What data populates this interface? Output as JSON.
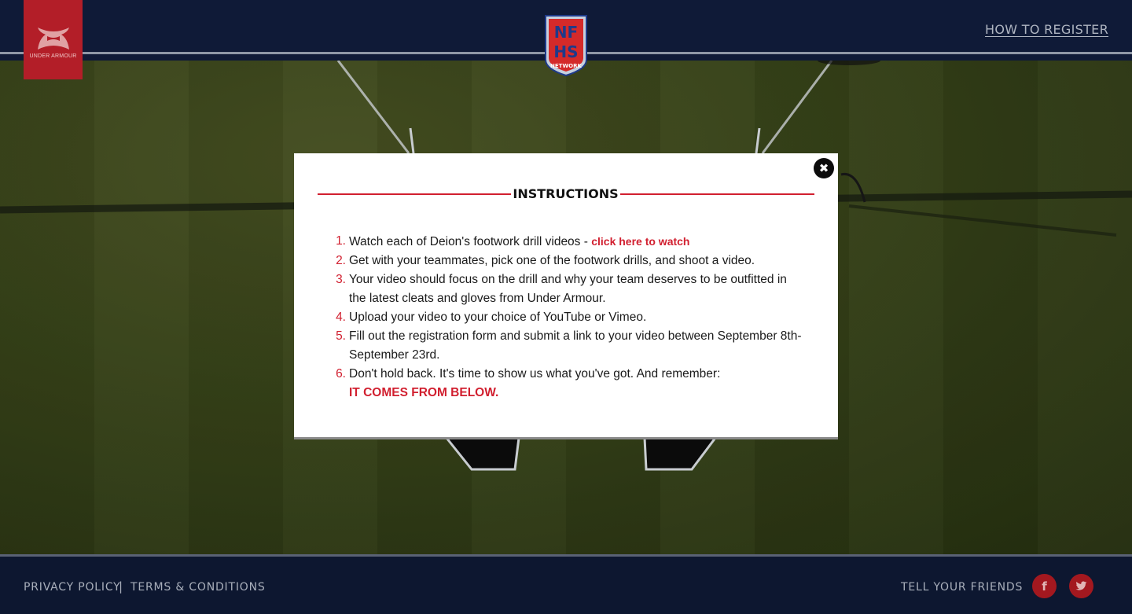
{
  "header": {
    "brand_text": "UNDER ARMOUR",
    "partner_logo_text": [
      "NF",
      "HS",
      "NETWORK"
    ],
    "how_to_register": "HOW TO REGISTER"
  },
  "modal": {
    "title": "INSTRUCTIONS",
    "close_icon": "close-icon",
    "steps": [
      {
        "num": "1.",
        "text": "Watch each of Deion's footwork drill videos - ",
        "link": "click here to watch"
      },
      {
        "num": "2.",
        "text": "Get with your teammates, pick one of the footwork drills, and shoot a video."
      },
      {
        "num": "3.",
        "text": "Your video should focus on the drill and why your team deserves to be outfitted in the latest cleats and gloves from Under Armour."
      },
      {
        "num": "4.",
        "text": "Upload your video to your choice of YouTube or Vimeo."
      },
      {
        "num": "5.",
        "text": "Fill out the registration form and submit a link to your video between September 8th-September 23rd."
      },
      {
        "num": "6.",
        "text": "Don't hold back. It's time to show us what you've got. And remember:",
        "tagline": "IT COMES FROM BELOW."
      }
    ]
  },
  "footer": {
    "privacy": "PRIVACY POLICY",
    "separator": "|",
    "terms": "TERMS & CONDITIONS",
    "tell_friends": "TELL YOUR FRIENDS",
    "facebook": "f",
    "twitter": "t"
  },
  "colors": {
    "accent_red": "#d11f2f",
    "navy": "#0f1a37"
  }
}
